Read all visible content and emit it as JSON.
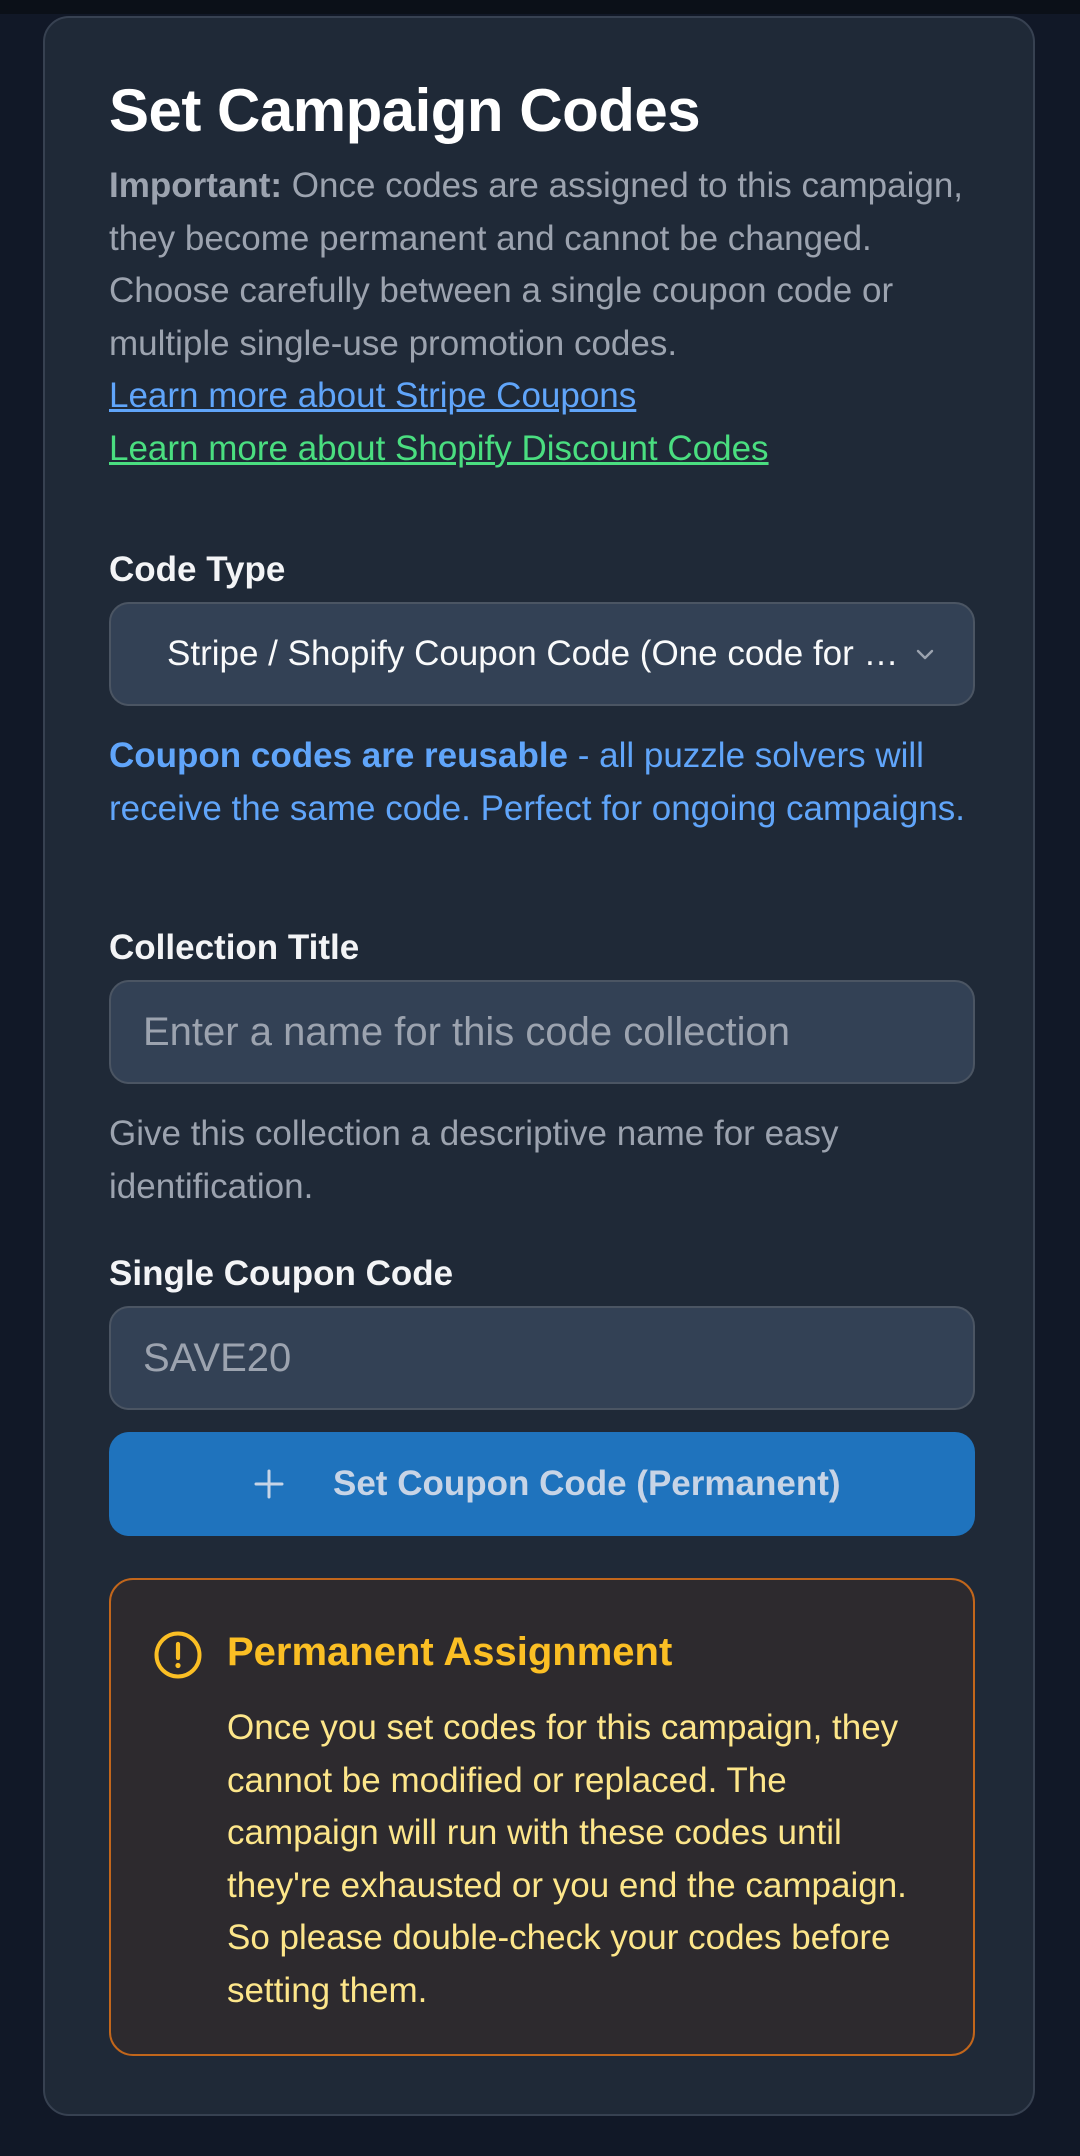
{
  "header": {
    "title": "Set Campaign Codes",
    "important_label": "Important:",
    "important_text": "Once codes are assigned to this campaign, they become permanent and cannot be changed. Choose carefully between a single coupon code or multiple single-use promotion codes.",
    "link_stripe": "Learn more about Stripe Coupons",
    "link_shopify": "Learn more about Shopify Discount Codes"
  },
  "code_type": {
    "label": "Code Type",
    "selected": "Stripe / Shopify Coupon Code (One code for all users)",
    "hint_bold": "Coupon codes are reusable",
    "hint_text": " - all puzzle solvers will receive the same code. Perfect for ongoing campaigns."
  },
  "collection_title": {
    "label": "Collection Title",
    "placeholder": "Enter a name for this code collection",
    "value": "",
    "hint": "Give this collection a descriptive name for easy identification."
  },
  "single_coupon": {
    "label": "Single Coupon Code",
    "placeholder": "SAVE20",
    "value": ""
  },
  "set_button": {
    "icon": "plus-icon",
    "label": "Set Coupon Code (Permanent)"
  },
  "warning": {
    "icon": "alert-circle-icon",
    "title": "Permanent Assignment",
    "body": "Once you set codes for this campaign, they cannot be modified or replaced. The campaign will run with these codes until they're exhausted or you end the campaign. So please double-check your codes before setting them."
  },
  "colors": {
    "background": "#111827",
    "card": "#1f2937",
    "accent_blue": "#60a5fa",
    "accent_green": "#4ade80",
    "button": "#1f73bd",
    "warning_border": "#c2661b",
    "warning_title": "#fbbf24"
  }
}
